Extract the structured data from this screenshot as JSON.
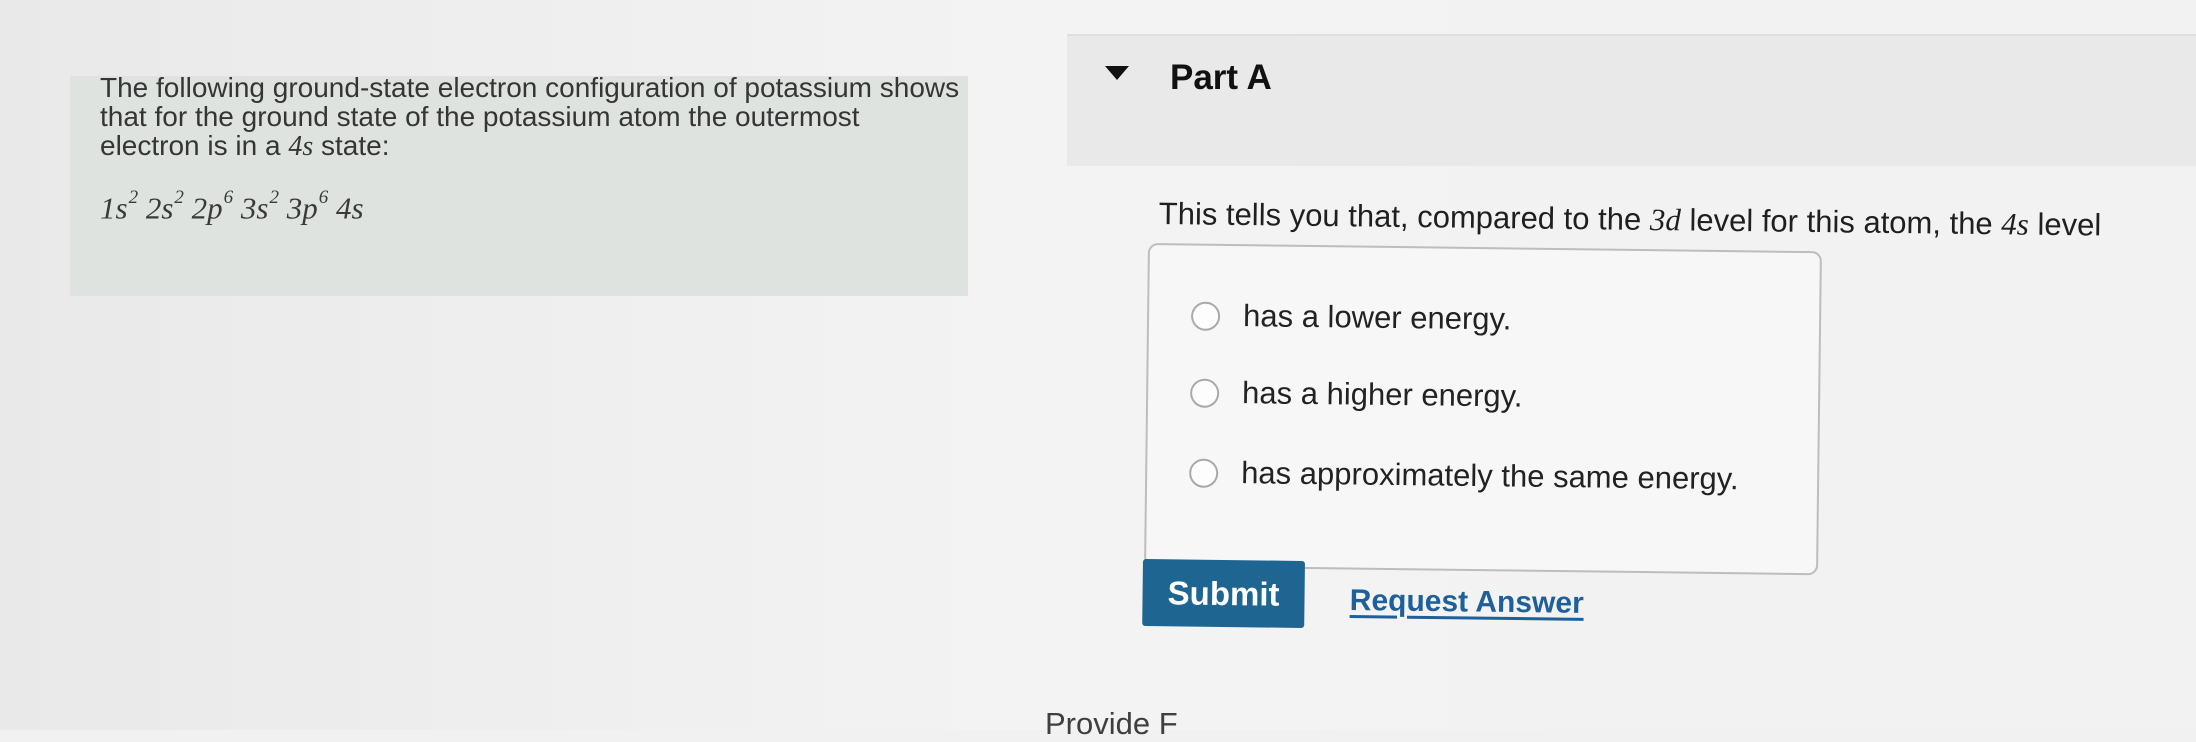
{
  "left_panel": {
    "intro_part1": "The following ground-state electron configuration of potassium shows that for the ground state of the potassium atom the outermost electron is in a ",
    "intro_math": "4s",
    "intro_part2": " state:",
    "config": {
      "term1": "1s",
      "exp1": "2",
      "term2": "2s",
      "exp2": "2",
      "term3": "2p",
      "exp3": "6",
      "term4": "3s",
      "exp4": "2",
      "term5": "3p",
      "exp5": "6",
      "term6": "4s"
    }
  },
  "part": {
    "title": "Part A",
    "question_prefix": "This tells you that, compared to the ",
    "question_math1": "3d",
    "question_middle": " level for this atom, the ",
    "question_math2": "4s",
    "question_suffix": " level"
  },
  "choices": [
    {
      "label": "has a lower energy."
    },
    {
      "label": "has a higher energy."
    },
    {
      "label": "has approximately the same energy."
    }
  ],
  "actions": {
    "submit_label": "Submit",
    "request_answer_label": "Request Answer"
  },
  "footer": {
    "partial_text": "Provide F"
  }
}
